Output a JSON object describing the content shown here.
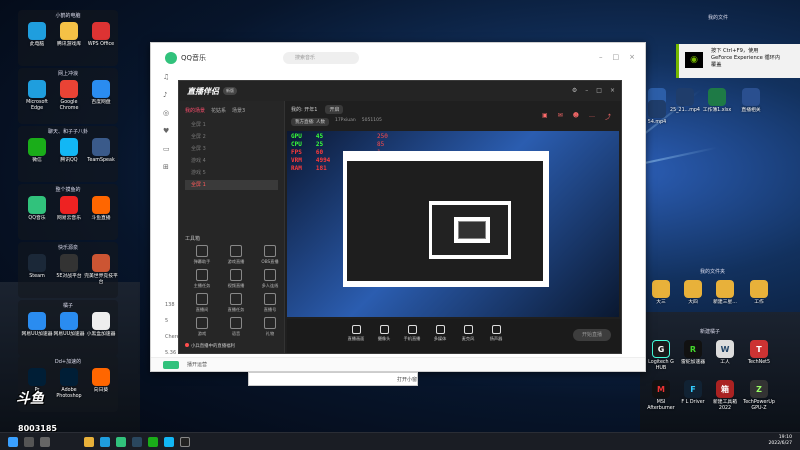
{
  "desktop": {
    "groups": [
      {
        "title": "小鹤的电脑",
        "items": [
          "此电脑",
          "腾讯游戏库",
          "WPS Office"
        ]
      },
      {
        "title": "网上冲浪",
        "items": [
          "Microsoft Edge",
          "Google Chrome",
          "百度网盘"
        ]
      },
      {
        "title": "聊天、和子子八卦",
        "items": [
          "微信",
          "腾讯QQ",
          "TeamSpeak"
        ]
      },
      {
        "title": "整个摸鱼的",
        "items": [
          "QQ音乐",
          "网易云音乐",
          "斗鱼直播"
        ]
      },
      {
        "title": "快乐源泉",
        "items": [
          "Steam",
          "5E对战平台",
          "完美世界竞技平台"
        ]
      },
      {
        "title": "橘子",
        "items": [
          "网易UU加速器",
          "网易UU加速器",
          "小黑盒加速器"
        ]
      },
      {
        "title": "Dd+加速的",
        "items": [
          "Pr",
          "Adobe Photoshop",
          "向日葵"
        ]
      }
    ],
    "right_top_title": "我的文件",
    "right_mid_title": "我的文件夹",
    "right_tools_title": "新建橘子",
    "right_files": [
      "Studio",
      "54.mp4",
      "25_21...mp4",
      "工作簿1.xlsx",
      "直播相关",
      "大三",
      "大四",
      "新建三星...",
      "工作"
    ],
    "right_apps": [
      "Logitech G HUB",
      "雷蛇加速器",
      "工人",
      "TechNet5",
      "MSI Afterburner",
      "F L Driver",
      "新建工具箱2022",
      "TechPowerUp GPU-Z"
    ]
  },
  "qq_music": {
    "title": "QQ音乐",
    "search_placeholder": "搜索音乐",
    "side_numbers": [
      "138",
      "5",
      "Chere",
      "5.36"
    ],
    "footer": "播开运营"
  },
  "streamer_app": {
    "title": "直播伴侣",
    "version": "新版",
    "tabs": [
      "我的场景",
      "花姑系",
      "场景3"
    ],
    "scenes": [
      "全屏 1",
      "全屏 2",
      "全屏 3",
      "游戏 4",
      "游戏 5",
      "全屏 1"
    ],
    "top_label": "我的: 开年1",
    "top_pill": "开启",
    "row2": [
      "我方直播: 人数",
      "17Pxiuan",
      "5051105"
    ],
    "tools_title": "工具箱",
    "tools": [
      "弹幕助手",
      "游戏直播",
      "OBS直播",
      "主播任务",
      "视频直播",
      "多人连线",
      "直播间",
      "直播任务",
      "直播号",
      "游戏",
      "语音",
      "礼物"
    ],
    "notice": "小兵直播中的直播福利",
    "bottom_buttons": [
      "直播画面",
      "摄像头",
      "手机直播",
      "多媒体",
      "麦克风",
      "扬声器"
    ],
    "go_live": "开始直播",
    "stats": [
      {
        "label": "GPU",
        "value": "45",
        "color": "#39ff39"
      },
      {
        "label": "CPU",
        "value": "25",
        "color": "#39ff39"
      },
      {
        "label": "FPS",
        "value": "60",
        "color": "#ff3b3b"
      },
      {
        "label": "VRM",
        "value": "4994",
        "color": "#ff3b3b"
      },
      {
        "label": "RAM",
        "value": "181",
        "color": "#ff3b3b"
      }
    ],
    "stats2": [
      {
        "value": "250",
        "color": "#ff4a4a"
      },
      {
        "value": "85",
        "color": "#ff4a4a"
      },
      {
        "value": "1",
        "color": "#ff4a4a"
      }
    ]
  },
  "nvidia": {
    "text_line1": "按下 Ctrl+F9，使用",
    "text_line2": "GeForce Experience 循环内",
    "text_line3": "覆盖"
  },
  "overlay": {
    "logo": "斗鱼",
    "room_id": "8003185"
  },
  "minibar": {
    "label": "打开小窗"
  },
  "taskbar": {
    "time": "19:10",
    "date": "2022/6/27"
  }
}
